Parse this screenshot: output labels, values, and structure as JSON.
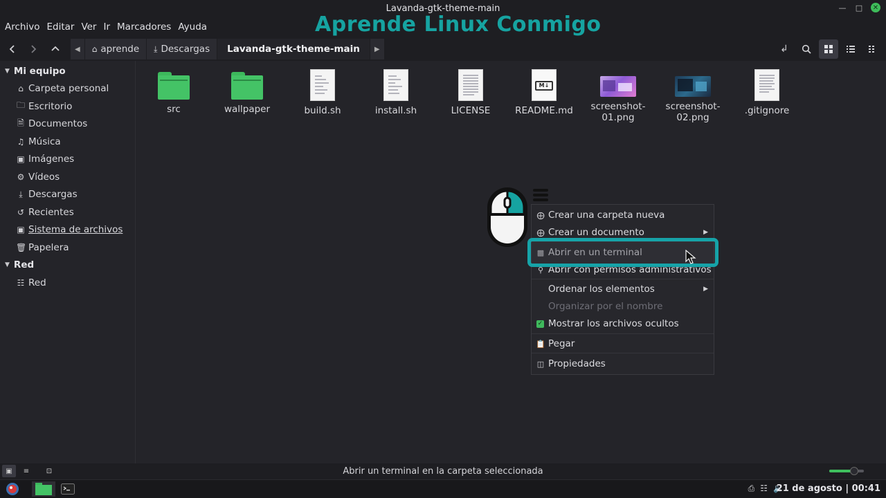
{
  "window": {
    "title": "Lavanda-gtk-theme-main"
  },
  "watermark": "Aprende Linux Conmigo",
  "menu": [
    "Archivo",
    "Editar",
    "Ver",
    "Ir",
    "Marcadores",
    "Ayuda"
  ],
  "breadcrumbs": [
    {
      "label": "aprende",
      "icon": "home-icon"
    },
    {
      "label": "Descargas",
      "icon": "download-icon"
    },
    {
      "label": "Lavanda-gtk-theme-main",
      "icon": ""
    }
  ],
  "sidebar": {
    "sections": [
      {
        "label": "Mi equipo",
        "items": [
          {
            "label": "Carpeta personal",
            "icon": "home-icon"
          },
          {
            "label": "Escritorio",
            "icon": "folder-icon"
          },
          {
            "label": "Documentos",
            "icon": "document-icon"
          },
          {
            "label": "Música",
            "icon": "music-icon"
          },
          {
            "label": "Imágenes",
            "icon": "image-icon"
          },
          {
            "label": "Vídeos",
            "icon": "video-icon"
          },
          {
            "label": "Descargas",
            "icon": "download-icon"
          },
          {
            "label": "Recientes",
            "icon": "history-icon"
          },
          {
            "label": "Sistema de archivos",
            "icon": "drive-icon"
          },
          {
            "label": "Papelera",
            "icon": "trash-icon"
          }
        ]
      },
      {
        "label": "Red",
        "items": [
          {
            "label": "Red",
            "icon": "network-icon"
          }
        ]
      }
    ]
  },
  "files": [
    {
      "name": "src",
      "type": "folder"
    },
    {
      "name": "wallpaper",
      "type": "folder"
    },
    {
      "name": "build.sh",
      "type": "script"
    },
    {
      "name": "install.sh",
      "type": "script"
    },
    {
      "name": "LICENSE",
      "type": "text"
    },
    {
      "name": "README.md",
      "type": "markdown"
    },
    {
      "name": "screenshot-01.png",
      "name_line1": "screenshot-",
      "name_line2": "01.png",
      "type": "image"
    },
    {
      "name": "screenshot-02.png",
      "name_line1": "screenshot-",
      "name_line2": "02.png",
      "type": "image"
    },
    {
      "name": ".gitignore",
      "type": "text"
    }
  ],
  "context_menu": {
    "items": [
      {
        "label": "Crear una carpeta nueva",
        "icon": "new-folder-icon"
      },
      {
        "label": "Crear un documento",
        "icon": "new-document-icon",
        "submenu": true
      },
      {
        "label": "Abrir en un terminal",
        "icon": "terminal-icon",
        "highlighted": true
      },
      {
        "label": "Abrir con permisos administrativos",
        "icon": "key-icon"
      },
      {
        "label": "Ordenar los elementos",
        "submenu": true
      },
      {
        "label": "Organizar por el nombre",
        "disabled": true
      },
      {
        "label": "Mostrar los archivos ocultos",
        "checked": true
      },
      {
        "label": "Pegar",
        "icon": "clipboard-icon"
      },
      {
        "label": "Propiedades",
        "icon": "properties-icon"
      }
    ]
  },
  "statusbar": {
    "text": "Abrir un terminal en la carpeta seleccionada",
    "zoom": 0.72
  },
  "taskbar": {
    "clock": "21 de agosto | 00:41"
  },
  "colors": {
    "accent": "#16a3a1",
    "folder": "#44c366",
    "checkbox": "#3fb85c"
  }
}
